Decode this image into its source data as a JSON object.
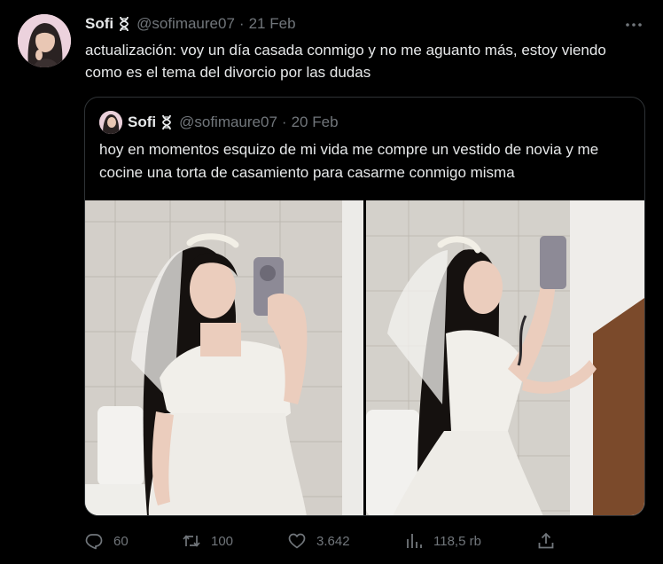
{
  "tweet": {
    "author_name": "Sofi",
    "author_handle": "@sofimaure07",
    "separator": "·",
    "date": "21 Feb",
    "text": "actualización: voy un día casada conmigo y no me aguanto más, estoy viendo como es el tema del divorcio por las dudas"
  },
  "quote": {
    "author_name": "Sofi",
    "author_handle": "@sofimaure07",
    "separator": "·",
    "date": "20 Feb",
    "text": "hoy en momentos esquizo de mi vida me compre un vestido de novia y me cocine una torta de casamiento para casarme conmigo misma"
  },
  "actions": {
    "replies": "60",
    "reposts": "100",
    "likes": "3.642",
    "views": "118,5 rb"
  },
  "icons": {
    "more": "more-horizontal-icon",
    "reply": "reply-icon",
    "repost": "repost-icon",
    "like": "heart-icon",
    "views": "views-chart-icon",
    "share": "share-icon",
    "badge": "dna-badge-icon"
  },
  "colors": {
    "background": "#000000",
    "text": "#e7e9ea",
    "muted": "#71767b",
    "border": "#2f3336"
  }
}
